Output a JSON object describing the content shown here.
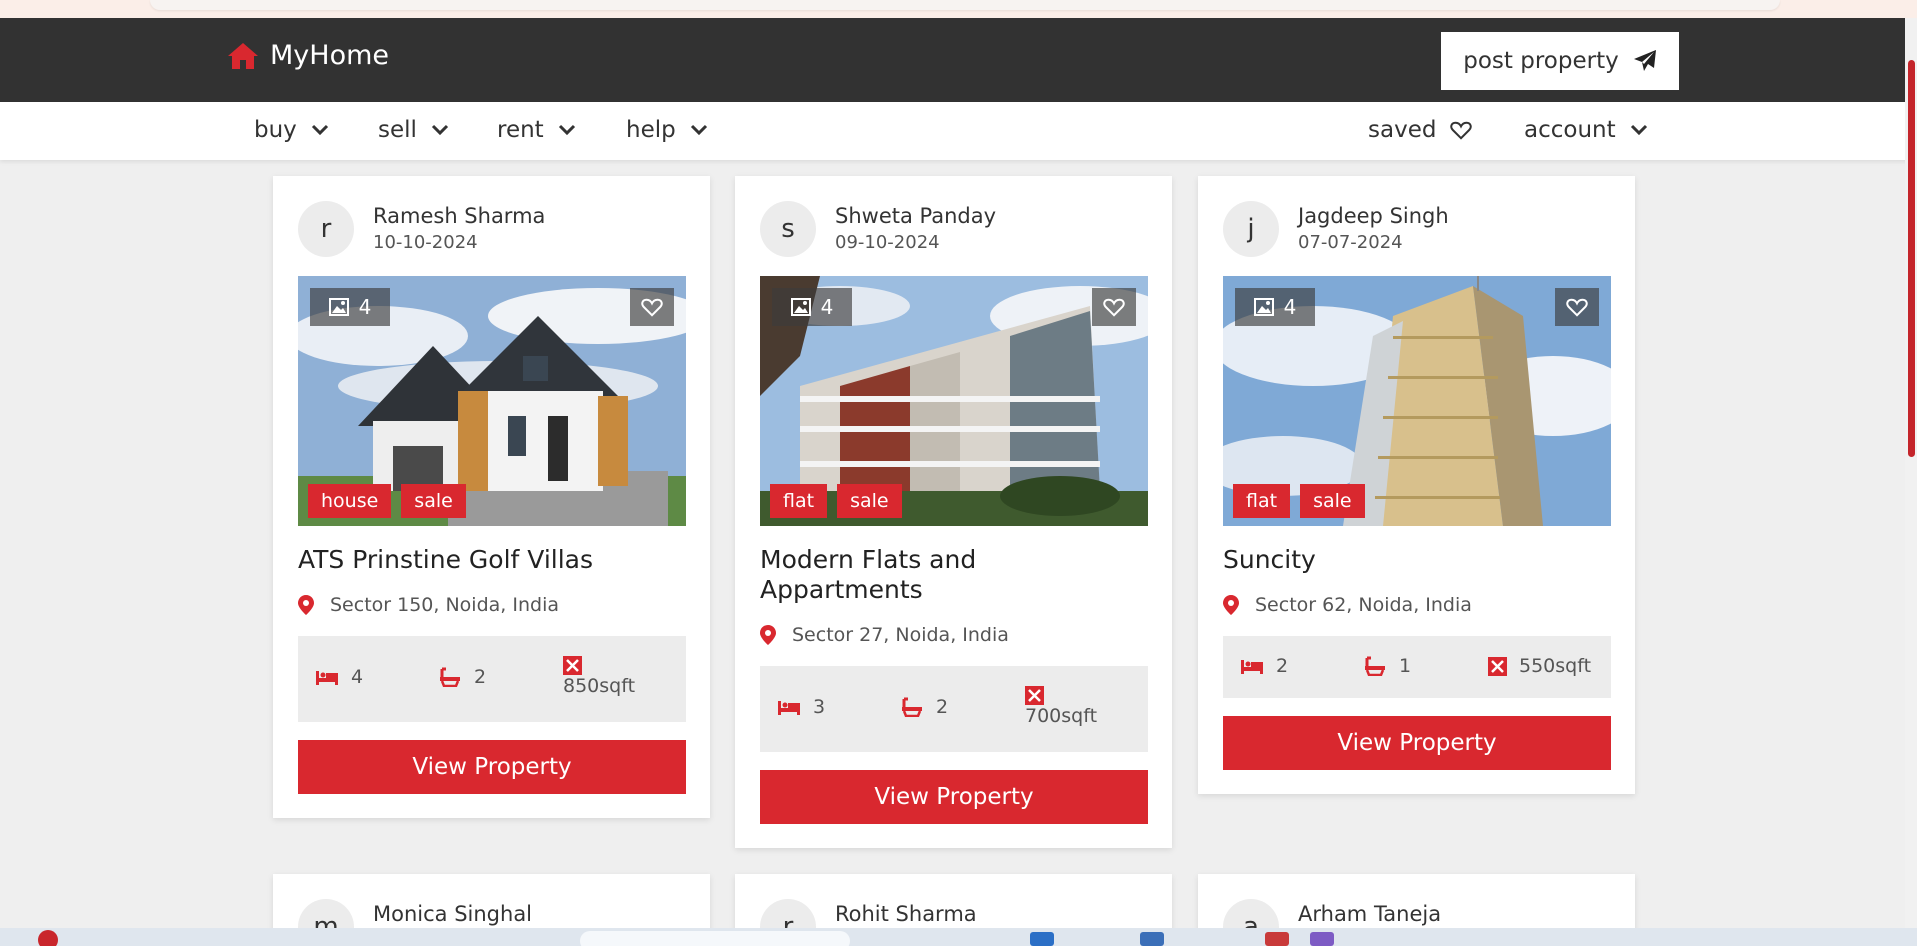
{
  "colors": {
    "accent": "#d9282f",
    "header_bg": "#323232",
    "page_bg": "#efefef"
  },
  "header": {
    "logo_icon": "home-icon",
    "brand": "MyHome",
    "post_label": "post property",
    "post_icon": "paper-plane-icon"
  },
  "nav": {
    "left": [
      "buy",
      "sell",
      "rent",
      "help"
    ],
    "saved": "saved",
    "account": "account"
  },
  "listings": [
    {
      "initial": "r",
      "agent": "Ramesh Sharma",
      "date": "10-10-2024",
      "images": "4",
      "tags": [
        "house",
        "sale"
      ],
      "title": "ATS Prinstine Golf Villas",
      "location": "Sector 150, Noida, India",
      "beds": "4",
      "baths": "2",
      "area": "850sqft",
      "cta": "View Property"
    },
    {
      "initial": "s",
      "agent": "Shweta Panday",
      "date": "09-10-2024",
      "images": "4",
      "tags": [
        "flat",
        "sale"
      ],
      "title_line1": "Modern Flats and",
      "title_line2": "Appartments",
      "location": "Sector 27, Noida, India",
      "beds": "3",
      "baths": "2",
      "area": "700sqft",
      "cta": "View Property"
    },
    {
      "initial": "j",
      "agent": "Jagdeep Singh",
      "date": "07-07-2024",
      "images": "4",
      "tags": [
        "flat",
        "sale"
      ],
      "title": "Suncity",
      "location": "Sector 62, Noida, India",
      "beds": "2",
      "baths": "1",
      "area": "550sqft",
      "cta": "View Property"
    }
  ],
  "next_row": [
    {
      "initial": "m",
      "agent": "Monica Singhal"
    },
    {
      "initial": "r",
      "agent": "Rohit Sharma"
    },
    {
      "initial": "a",
      "agent": "Arham Taneja"
    }
  ]
}
